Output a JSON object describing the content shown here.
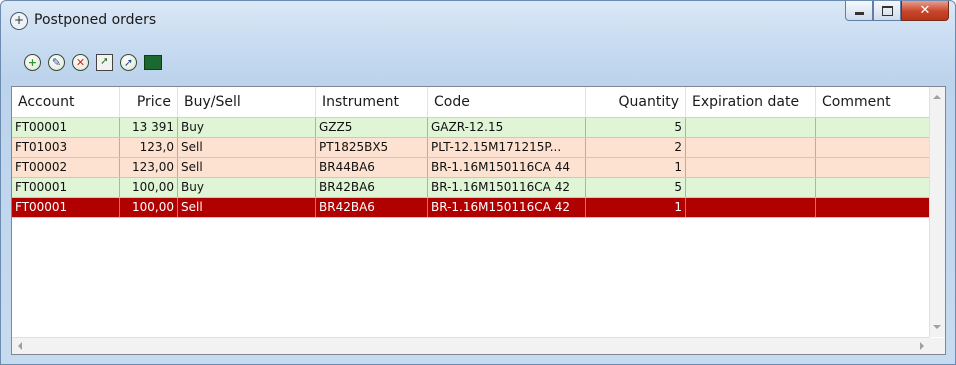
{
  "window": {
    "title": "Postponed orders",
    "title_icon": "order-plus-icon"
  },
  "toolbar": {
    "icons": [
      "add-order-icon",
      "edit-order-icon",
      "delete-order-icon",
      "export-order-icon",
      "send-order-icon",
      "move-order-icon"
    ]
  },
  "table": {
    "columns": [
      "Account",
      "Price",
      "Buy/Sell",
      "Instrument",
      "Code",
      "Quantity",
      "Expiration date",
      "Comment"
    ],
    "rows": [
      {
        "account": "FT00001",
        "price": "13 391",
        "side": "Buy",
        "instrument": "GZZ5",
        "code": "GAZR-12.15",
        "quantity": "5",
        "expiration": "",
        "comment": ""
      },
      {
        "account": "FT01003",
        "price": "123,0",
        "side": "Sell",
        "instrument": "PT1825BX5",
        "code": "PLT-12.15M171215P...",
        "quantity": "2",
        "expiration": "",
        "comment": ""
      },
      {
        "account": "FT00002",
        "price": "123,00",
        "side": "Sell",
        "instrument": "BR44BA6",
        "code": "BR-1.16M150116CA 44",
        "quantity": "1",
        "expiration": "",
        "comment": ""
      },
      {
        "account": "FT00001",
        "price": "100,00",
        "side": "Buy",
        "instrument": "BR42BA6",
        "code": "BR-1.16M150116CA 42",
        "quantity": "5",
        "expiration": "",
        "comment": ""
      },
      {
        "account": "FT00001",
        "price": "100,00",
        "side": "Sell",
        "instrument": "BR42BA6",
        "code": "BR-1.16M150116CA 42",
        "quantity": "1",
        "expiration": "",
        "comment": ""
      }
    ],
    "selected_row": 4
  },
  "colors": {
    "buy_row": "#dff5d6",
    "sell_row": "#fde2d2",
    "selected_row": "#b10000"
  }
}
